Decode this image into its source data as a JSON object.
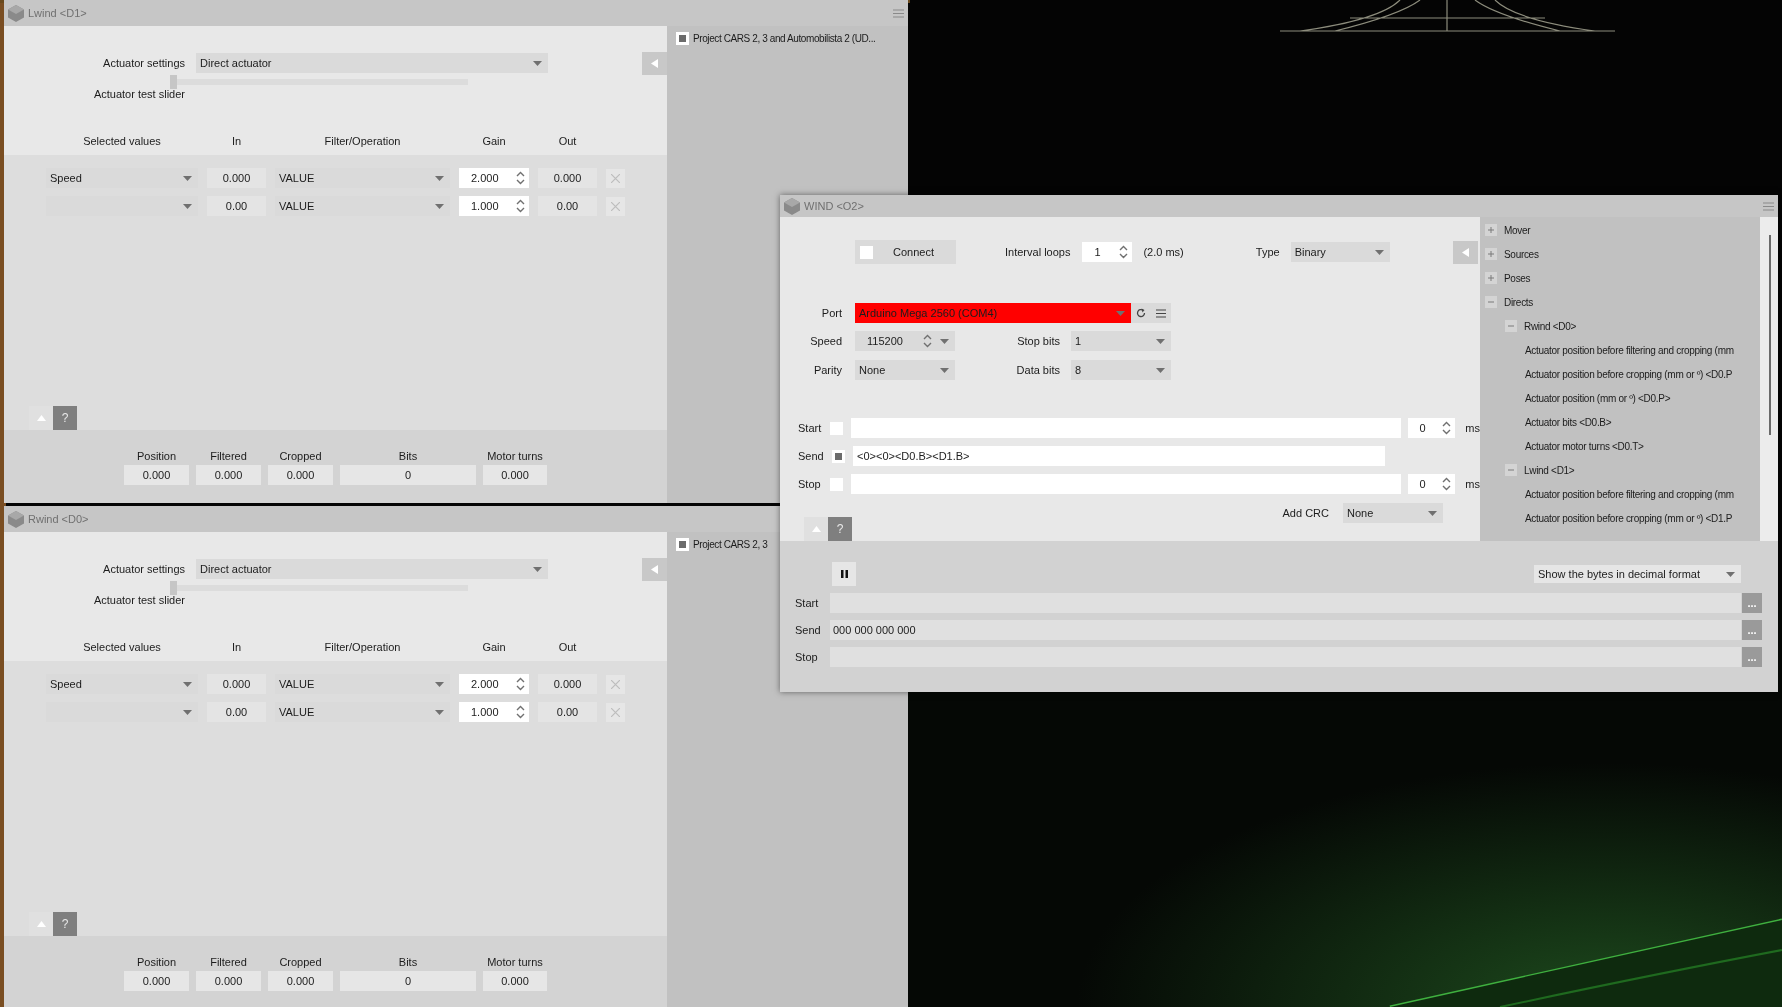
{
  "actuator_windows": [
    {
      "title": "Lwind <D1>",
      "settings": {
        "label": "Actuator settings",
        "value": "Direct actuator"
      },
      "slider": {
        "label": "Actuator test slider",
        "level": 0
      },
      "columns": [
        "Selected values",
        "In",
        "Filter/Operation",
        "Gain",
        "Out"
      ],
      "rows": [
        {
          "value": "Speed",
          "in": "0.000",
          "filter": "VALUE",
          "gain": "2.000",
          "out": "0.000"
        },
        {
          "in": "0.00",
          "filter": "VALUE",
          "gain": "1.000",
          "out": "0.00"
        }
      ],
      "help": "?",
      "summary": [
        {
          "label": "Position",
          "value": "0.000"
        },
        {
          "label": "Filtered",
          "value": "0.000"
        },
        {
          "label": "Cropped",
          "value": "0.000"
        },
        {
          "label": "Bits",
          "value": "0"
        },
        {
          "label": "Motor turns",
          "value": "0.000"
        }
      ],
      "game": {
        "label": "Project CARS 2, 3 and Automobilista 2 (UD...",
        "checked": true
      }
    },
    {
      "title": "Rwind <D0>",
      "settings": {
        "label": "Actuator settings",
        "value": "Direct actuator"
      },
      "slider": {
        "label": "Actuator test slider",
        "level": 0
      },
      "columns": [
        "Selected values",
        "In",
        "Filter/Operation",
        "Gain",
        "Out"
      ],
      "rows": [
        {
          "value": "Speed",
          "in": "0.000",
          "filter": "VALUE",
          "gain": "2.000",
          "out": "0.000"
        },
        {
          "in": "0.00",
          "filter": "VALUE",
          "gain": "1.000",
          "out": "0.00"
        }
      ],
      "help": "?",
      "summary": [
        {
          "label": "Position",
          "value": "0.000"
        },
        {
          "label": "Filtered",
          "value": "0.000"
        },
        {
          "label": "Cropped",
          "value": "0.000"
        },
        {
          "label": "Bits",
          "value": "0"
        },
        {
          "label": "Motor turns",
          "value": "0.000"
        }
      ],
      "game": {
        "label": "Project CARS 2, 3",
        "checked": true
      }
    }
  ],
  "output_window": {
    "title": "WIND <O2>",
    "connect": {
      "label": "Connect",
      "checked": false
    },
    "interval": {
      "label": "Interval loops",
      "value": "1",
      "note": "(2.0 ms)"
    },
    "type": {
      "label": "Type",
      "value": "Binary"
    },
    "port": {
      "label": "Port",
      "value": "Arduino Mega 2560 (COM4)",
      "error": true
    },
    "speed": {
      "label": "Speed",
      "value": "115200"
    },
    "stop_bits": {
      "label": "Stop bits",
      "value": "1"
    },
    "parity": {
      "label": "Parity",
      "value": "None"
    },
    "data_bits": {
      "label": "Data bits",
      "value": "8"
    },
    "frames": [
      {
        "label": "Start",
        "checked": false,
        "delay": "0",
        "unit": "ms"
      },
      {
        "label": "Send",
        "checked": true,
        "value": "<0><0><D0.B><D1.B>"
      },
      {
        "label": "Stop",
        "checked": false,
        "delay": "0",
        "unit": "ms"
      }
    ],
    "crc": {
      "label": "Add CRC",
      "value": "None"
    },
    "help": "?",
    "bytes_format": "Show the bytes in decimal format",
    "monitor": [
      {
        "label": "Start",
        "button": "..."
      },
      {
        "label": "Send",
        "value": "000 000 000 000",
        "button": "..."
      },
      {
        "label": "Stop",
        "button": "..."
      }
    ],
    "tree": [
      {
        "label": "Mover",
        "expanded": false
      },
      {
        "label": "Sources",
        "expanded": false
      },
      {
        "label": "Poses",
        "expanded": false
      },
      {
        "label": "Directs",
        "expanded": true,
        "children": [
          {
            "label": "Rwind <D0>",
            "expanded": true,
            "children": [
              {
                "label": "Actuator position before filtering and cropping (mm"
              },
              {
                "label": "Actuator position before cropping (mm or º) <D0.P"
              },
              {
                "label": "Actuator position (mm or º) <D0.P>"
              },
              {
                "label": "Actuator bits <D0.B>"
              },
              {
                "label": "Actuator motor turns <D0.T>"
              }
            ]
          },
          {
            "label": "Lwind <D1>",
            "expanded": true,
            "children": [
              {
                "label": "Actuator position before filtering and cropping (mm"
              },
              {
                "label": "Actuator position before cropping (mm or º) <D1.P"
              }
            ]
          }
        ]
      }
    ]
  }
}
